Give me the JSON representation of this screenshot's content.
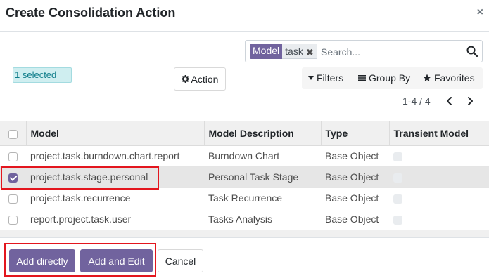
{
  "modal": {
    "title": "Create Consolidation Action",
    "close": "×"
  },
  "search": {
    "facet_label": "Model",
    "facet_value": "task",
    "facet_remove": "✖",
    "placeholder": "Search..."
  },
  "selection": {
    "badge": "1 selected"
  },
  "toolbar": {
    "action_label": "Action",
    "filters_label": "Filters",
    "groupby_label": "Group By",
    "favorites_label": "Favorites"
  },
  "pager": {
    "value": "1-4 / 4"
  },
  "table": {
    "headers": [
      "Model",
      "Model Description",
      "Type",
      "Transient Model"
    ],
    "rows": [
      {
        "model": "project.task.burndown.chart.report",
        "description": "Burndown Chart",
        "type": "Base Object",
        "selected": false
      },
      {
        "model": "project.task.stage.personal",
        "description": "Personal Task Stage",
        "type": "Base Object",
        "selected": true
      },
      {
        "model": "project.task.recurrence",
        "description": "Task Recurrence",
        "type": "Base Object",
        "selected": false
      },
      {
        "model": "report.project.task.user",
        "description": "Tasks Analysis",
        "type": "Base Object",
        "selected": false
      }
    ]
  },
  "footer": {
    "add_directly": "Add directly",
    "add_and_edit": "Add and Edit",
    "cancel": "Cancel"
  },
  "colors": {
    "primary": "#71639e",
    "highlight": "#e3161e",
    "badge_bg": "#cfeef0"
  }
}
